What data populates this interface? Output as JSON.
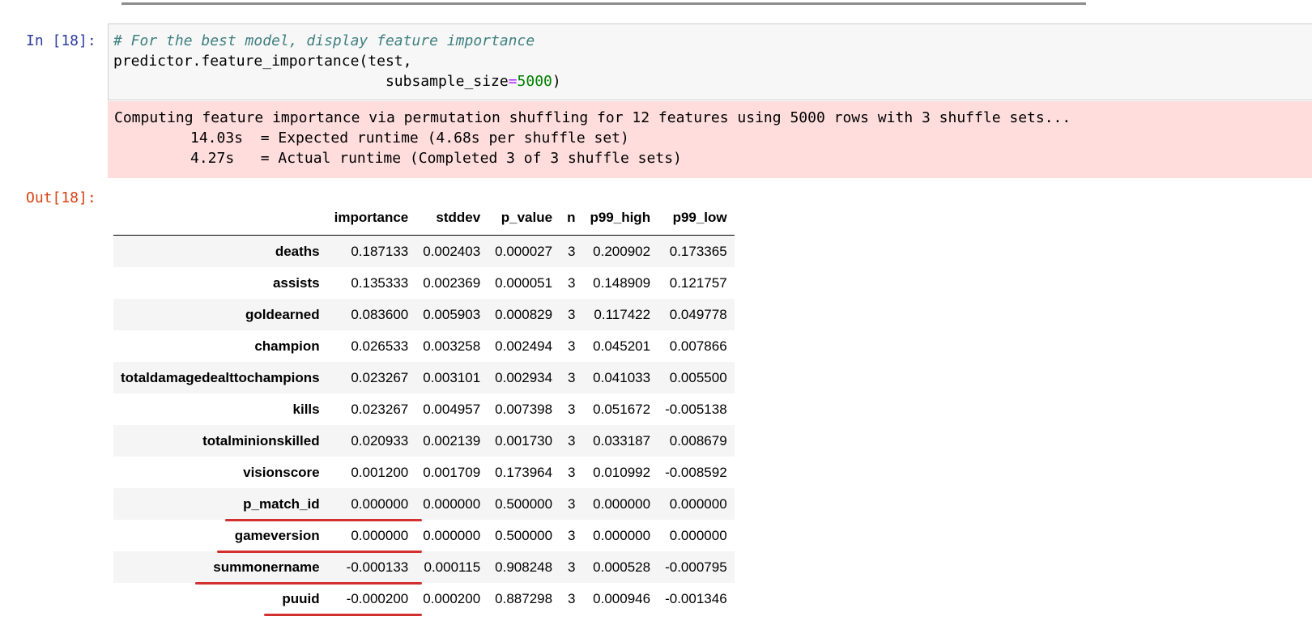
{
  "cell": {
    "in_prompt": "In [18]:",
    "out_prompt": "Out[18]:",
    "code": {
      "comment": "# For the best model, display feature importance",
      "line2": "predictor.feature_importance(test,",
      "line3_indent": "                               ",
      "line3_arg": "subsample_size",
      "line3_eq": "=",
      "line3_val": "5000",
      "line3_close": ")"
    },
    "stderr": [
      "Computing feature importance via permutation shuffling for 12 features using 5000 rows with 3 shuffle sets...",
      "14.03s  = Expected runtime (4.68s per shuffle set)",
      "4.27s   = Actual runtime (Completed 3 of 3 shuffle sets)"
    ]
  },
  "table": {
    "columns": [
      "",
      "importance",
      "stddev",
      "p_value",
      "n",
      "p99_high",
      "p99_low"
    ],
    "rows": [
      [
        "deaths",
        "0.187133",
        "0.002403",
        "0.000027",
        "3",
        "0.200902",
        "0.173365"
      ],
      [
        "assists",
        "0.135333",
        "0.002369",
        "0.000051",
        "3",
        "0.148909",
        "0.121757"
      ],
      [
        "goldearned",
        "0.083600",
        "0.005903",
        "0.000829",
        "3",
        "0.117422",
        "0.049778"
      ],
      [
        "champion",
        "0.026533",
        "0.003258",
        "0.002494",
        "3",
        "0.045201",
        "0.007866"
      ],
      [
        "totaldamagedealttochampions",
        "0.023267",
        "0.003101",
        "0.002934",
        "3",
        "0.041033",
        "0.005500"
      ],
      [
        "kills",
        "0.023267",
        "0.004957",
        "0.007398",
        "3",
        "0.051672",
        "-0.005138"
      ],
      [
        "totalminionskilled",
        "0.020933",
        "0.002139",
        "0.001730",
        "3",
        "0.033187",
        "0.008679"
      ],
      [
        "visionscore",
        "0.001200",
        "0.001709",
        "0.173964",
        "3",
        "0.010992",
        "-0.008592"
      ],
      [
        "p_match_id",
        "0.000000",
        "0.000000",
        "0.500000",
        "3",
        "0.000000",
        "0.000000"
      ],
      [
        "gameversion",
        "0.000000",
        "0.000000",
        "0.500000",
        "3",
        "0.000000",
        "0.000000"
      ],
      [
        "summonername",
        "-0.000133",
        "0.000115",
        "0.908248",
        "3",
        "0.000528",
        "-0.000795"
      ],
      [
        "puuid",
        "-0.000200",
        "0.000200",
        "0.887298",
        "3",
        "0.000946",
        "-0.001346"
      ]
    ]
  },
  "annotation": {
    "color": "#d32f2f",
    "underlined_rows": [
      "p_match_id",
      "gameversion",
      "summonername",
      "puuid"
    ]
  }
}
